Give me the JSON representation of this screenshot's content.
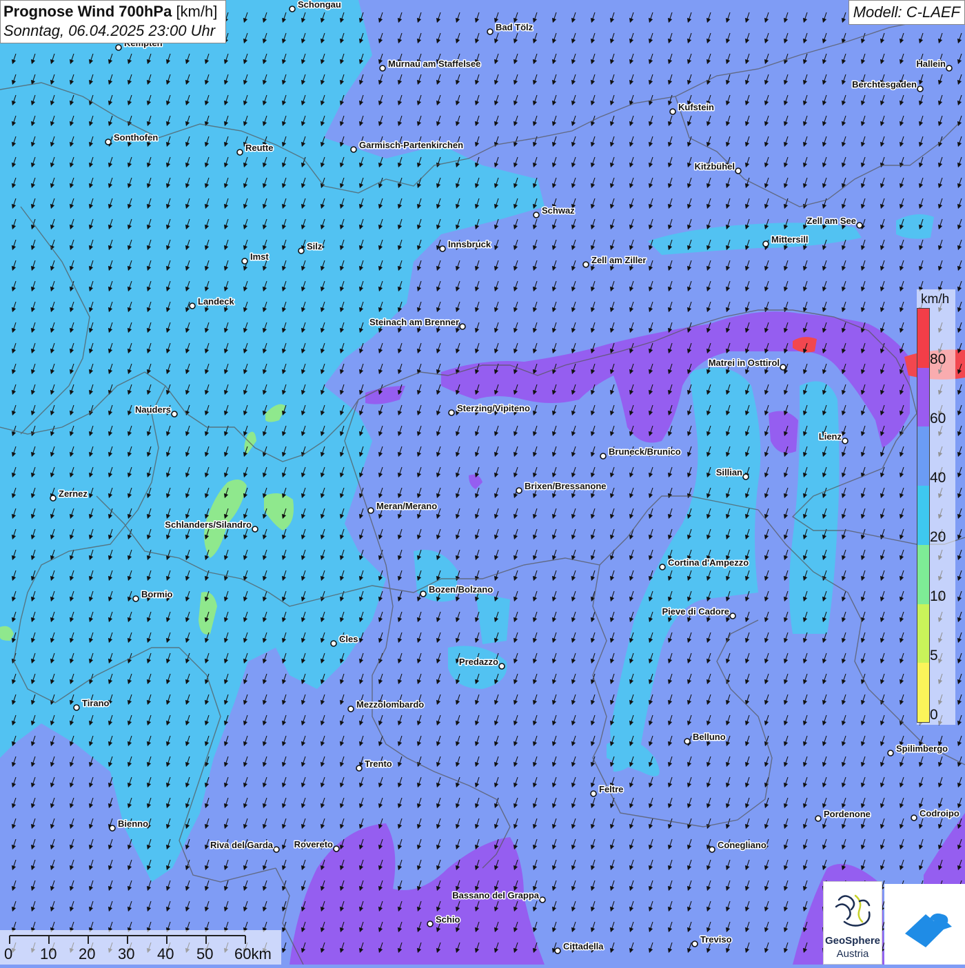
{
  "header": {
    "title": "Prognose Wind 700hPa",
    "unit": "[km/h]",
    "datetime": "Sonntag, 06.04.2025 23:00 Uhr",
    "model": "Modell: C-LAEF"
  },
  "legend": {
    "unit": "km/h",
    "ticks": [
      "0",
      "5",
      "10",
      "20",
      "40",
      "60",
      "80"
    ],
    "colors": [
      "#fbf45a",
      "#c9f35a",
      "#7eec96",
      "#3ec8ef",
      "#6b9cf5",
      "#9a5cf0",
      "#f23e48"
    ]
  },
  "scale_bar": {
    "labels": [
      "0",
      "10",
      "20",
      "30",
      "40",
      "50",
      "60km"
    ]
  },
  "logos": {
    "geosphere_line1": "GeoSphere",
    "geosphere_line2": "Austria"
  },
  "wind": {
    "direction": "from north-northeast",
    "arrow_icon": "wind-arrow-icon"
  },
  "cities": [
    {
      "name": "Schongau",
      "pos": "right"
    },
    {
      "name": "Bad Tölz",
      "pos": "right"
    },
    {
      "name": "Kempten",
      "pos": "right"
    },
    {
      "name": "Murnau am Staffelsee",
      "pos": "right"
    },
    {
      "name": "Hallein",
      "pos": "left"
    },
    {
      "name": "Berchtesgaden",
      "pos": "left"
    },
    {
      "name": "Kufstein",
      "pos": "right"
    },
    {
      "name": "Sonthofen",
      "pos": "right"
    },
    {
      "name": "Reutte",
      "pos": "right"
    },
    {
      "name": "Garmisch-Partenkirchen",
      "pos": "right"
    },
    {
      "name": "Kitzbühel",
      "pos": "left"
    },
    {
      "name": "Schwaz",
      "pos": "right"
    },
    {
      "name": "Zell am See",
      "pos": "left"
    },
    {
      "name": "Mittersill",
      "pos": "right"
    },
    {
      "name": "Innsbruck",
      "pos": "right"
    },
    {
      "name": "Silz",
      "pos": "right"
    },
    {
      "name": "Imst",
      "pos": "right"
    },
    {
      "name": "Zell am Ziller",
      "pos": "right"
    },
    {
      "name": "Landeck",
      "pos": "right"
    },
    {
      "name": "Steinach am Brenner",
      "pos": "left"
    },
    {
      "name": "Matrei in Osttirol",
      "pos": "left"
    },
    {
      "name": "Nauders",
      "pos": "left"
    },
    {
      "name": "Sterzing/Vipiteno",
      "pos": "right"
    },
    {
      "name": "Lienz",
      "pos": "left"
    },
    {
      "name": "Bruneck/Brunico",
      "pos": "right"
    },
    {
      "name": "Sillian",
      "pos": "left"
    },
    {
      "name": "Zernez",
      "pos": "right"
    },
    {
      "name": "Brixen/Bressanone",
      "pos": "right"
    },
    {
      "name": "Meran/Merano",
      "pos": "right"
    },
    {
      "name": "Schlanders/Silandro",
      "pos": "left"
    },
    {
      "name": "Cortina d'Ampezzo",
      "pos": "right"
    },
    {
      "name": "Bozen/Bolzano",
      "pos": "right"
    },
    {
      "name": "Bormio",
      "pos": "right"
    },
    {
      "name": "Pieve di Cadore",
      "pos": "left"
    },
    {
      "name": "Cles",
      "pos": "right"
    },
    {
      "name": "Predazzo",
      "pos": "left"
    },
    {
      "name": "Tirano",
      "pos": "right"
    },
    {
      "name": "Mezzolombardo",
      "pos": "right"
    },
    {
      "name": "Belluno",
      "pos": "right"
    },
    {
      "name": "Spilimbergo",
      "pos": "right"
    },
    {
      "name": "Trento",
      "pos": "right"
    },
    {
      "name": "Feltre",
      "pos": "right"
    },
    {
      "name": "Bienno",
      "pos": "right"
    },
    {
      "name": "Pordenone",
      "pos": "right"
    },
    {
      "name": "Codroipo",
      "pos": "right"
    },
    {
      "name": "Riva del Garda",
      "pos": "left"
    },
    {
      "name": "Rovereto",
      "pos": "left"
    },
    {
      "name": "Conegliano",
      "pos": "right"
    },
    {
      "name": "Bassano del Grappa",
      "pos": "left"
    },
    {
      "name": "Schio",
      "pos": "right"
    },
    {
      "name": "Treviso",
      "pos": "right"
    },
    {
      "name": "Cittadella",
      "pos": "right"
    }
  ]
}
